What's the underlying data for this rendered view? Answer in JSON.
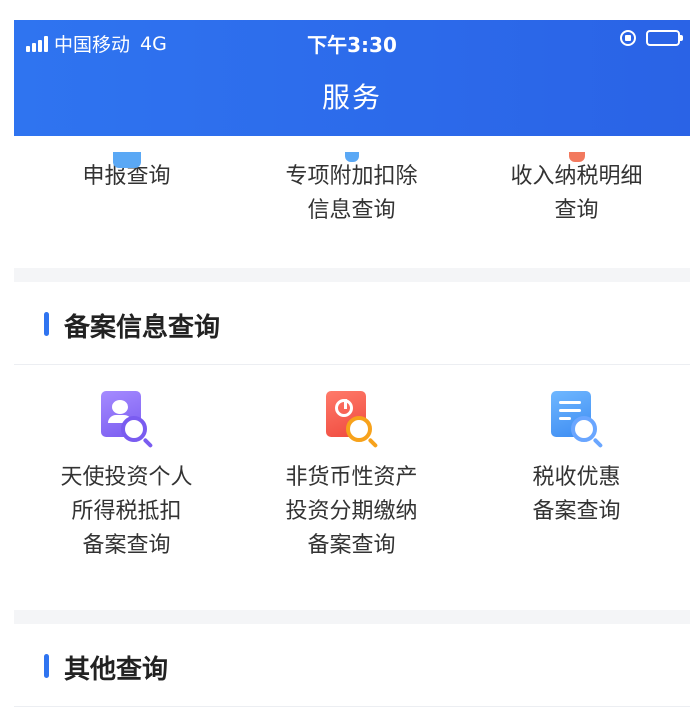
{
  "status_bar": {
    "carrier": "中国移动",
    "network": "4G",
    "time": "下午3:30"
  },
  "header": {
    "title": "服务"
  },
  "declaration_section": {
    "items": [
      {
        "label": "申报查询",
        "icon": "report-query-icon",
        "color": "#5aa8f5"
      },
      {
        "label": "专项附加扣除\n信息查询",
        "icon": "special-deduction-icon",
        "color": "#5aa8f5"
      },
      {
        "label": "收入纳税明细\n查询",
        "icon": "income-tax-detail-icon",
        "color": "#f2795e"
      }
    ]
  },
  "filing_section": {
    "title": "备案信息查询",
    "items": [
      {
        "label": "天使投资个人\n所得税抵扣\n备案查询",
        "icon": "angel-investor-icon"
      },
      {
        "label": "非货币性资产\n投资分期缴纳\n备案查询",
        "icon": "pie-chart-doc-icon"
      },
      {
        "label": "税收优惠\n备案查询",
        "icon": "list-doc-icon"
      }
    ]
  },
  "other_section": {
    "title": "其他查询"
  },
  "colors": {
    "header_blue": "#2f74f0",
    "accent_bar": "#2f74f0"
  }
}
